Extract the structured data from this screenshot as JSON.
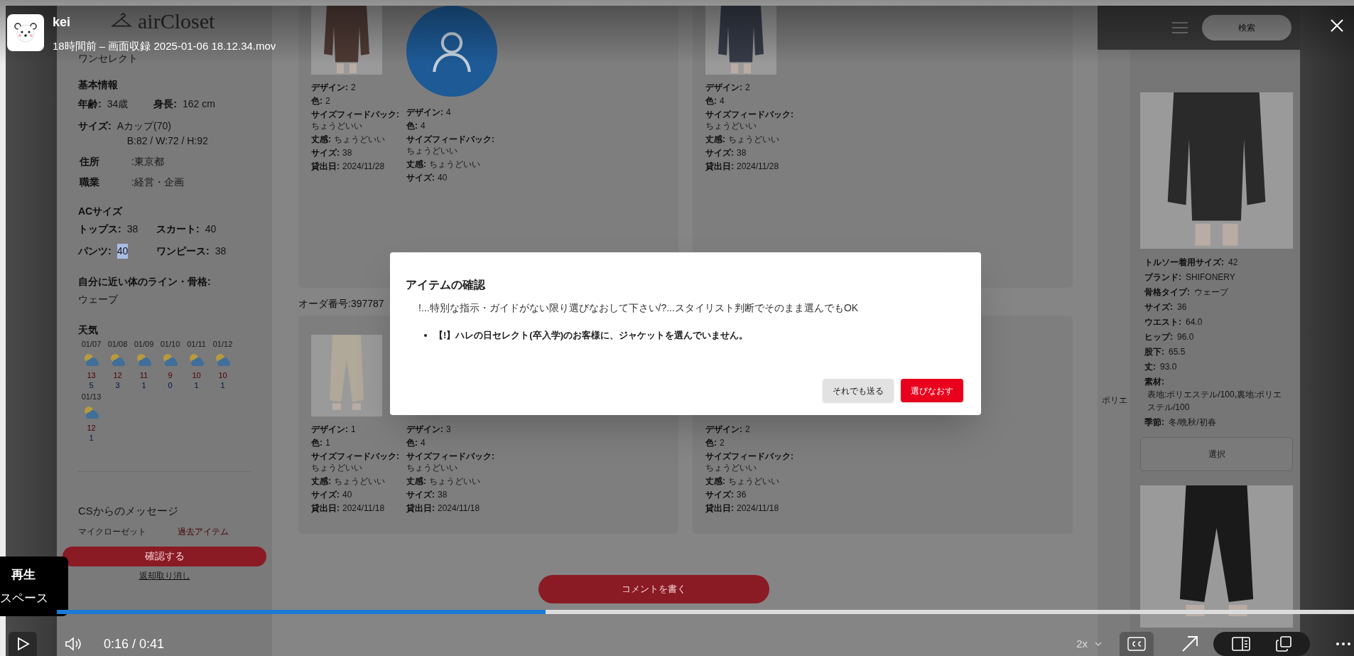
{
  "player": {
    "uploader": "kei",
    "subtitle": "18時間前 – 画面収録 2025-01-06 18.12.34.mov",
    "progress": {
      "level": 0.377
    },
    "time": "0:16 / 0:41",
    "speed": "2x",
    "captions_on": true,
    "tooltip": {
      "label": "再生",
      "shortcut": "スペース"
    }
  },
  "app": {
    "logo": "airCloset",
    "sidebar": {
      "plan": "ワンセレクト",
      "basic_title": "基本情報",
      "age": {
        "label": "年齢:",
        "value": "34歳"
      },
      "height": {
        "label": "身長:",
        "value": "162 cm"
      },
      "size": {
        "label": "サイズ:",
        "cup": "Aカップ(70)",
        "measurements": "B:82 / W:72 / H:92"
      },
      "address": {
        "label": "住所",
        "value": ":東京都"
      },
      "job": {
        "label": "職業",
        "value": ":経営・企画"
      },
      "ac_size": {
        "title": "ACサイズ",
        "sizes": [
          {
            "label": "トップス:",
            "value": "38",
            "selected": false
          },
          {
            "label": "スカート:",
            "value": "40",
            "selected": false
          },
          {
            "label": "パンツ:",
            "value": "40",
            "selected": true
          },
          {
            "label": "ワンピース:",
            "value": "38",
            "selected": false
          }
        ]
      },
      "body_line": {
        "label": "自分に近い体のライン・骨格:",
        "value": "ウェーブ"
      },
      "weather": {
        "title": "天気",
        "days": [
          {
            "date": "01/07",
            "high": "13",
            "low": "5"
          },
          {
            "date": "01/08",
            "high": "12",
            "low": "3"
          },
          {
            "date": "01/09",
            "high": "11",
            "low": "1"
          },
          {
            "date": "01/10",
            "high": "9",
            "low": "0"
          },
          {
            "date": "01/11",
            "high": "10",
            "low": "1"
          },
          {
            "date": "01/12",
            "high": "10",
            "low": "1"
          },
          {
            "date": "01/13",
            "high": "12",
            "low": "1"
          }
        ]
      },
      "cs_message": {
        "title": "CSからのメッセージ",
        "tabs": [
          {
            "label": "マイクローゼット",
            "selected": false
          },
          {
            "label": "過去アイテム",
            "selected": true
          }
        ],
        "confirm_button": "確認する",
        "cancel_link": "返却取り消し"
      }
    },
    "orders": [
      {
        "cards": [
          {
            "items": [
              {
                "fields": [
                  {
                    "label": "デザイン:",
                    "value": "2"
                  },
                  {
                    "label": "色:",
                    "value": "2"
                  },
                  {
                    "label": "サイズフィードバック:",
                    "value": "ちょうどいい",
                    "block": true
                  },
                  {
                    "label": "丈感:",
                    "value": "ちょうどいい"
                  },
                  {
                    "label": "サイズ:",
                    "value": "38"
                  },
                  {
                    "label": "貸出日:",
                    "value": "2024/11/28"
                  }
                ]
              },
              {
                "kind": "avatar",
                "fields": [
                  {
                    "label": "デザイン:",
                    "value": "4"
                  },
                  {
                    "label": "色:",
                    "value": "4"
                  },
                  {
                    "label": "サイズフィードバック:",
                    "value": "ちょうどいい",
                    "block": true
                  },
                  {
                    "label": "丈感:",
                    "value": "ちょうどいい"
                  },
                  {
                    "label": "サイズ:",
                    "value": "40"
                  }
                ]
              }
            ]
          },
          {
            "items": [
              {
                "fields": [
                  {
                    "label": "デザイン:",
                    "value": "2"
                  },
                  {
                    "label": "色:",
                    "value": "4"
                  },
                  {
                    "label": "サイズフィードバック:",
                    "value": "ちょうどいい",
                    "block": true
                  },
                  {
                    "label": "丈感:",
                    "value": "ちょうどいい"
                  },
                  {
                    "label": "サイズ:",
                    "value": "38"
                  },
                  {
                    "label": "貸出日:",
                    "value": "2024/11/28"
                  }
                ]
              }
            ]
          }
        ]
      },
      {
        "order_number": "オーダ番号:397787",
        "cards": [
          {
            "items": [
              {
                "fields": [
                  {
                    "label": "デザイン:",
                    "value": "1"
                  },
                  {
                    "label": "色:",
                    "value": "1"
                  },
                  {
                    "label": "サイズフィードバック:",
                    "value": "ちょうどいい",
                    "block": true
                  },
                  {
                    "label": "丈感:",
                    "value": "ちょうどいい"
                  },
                  {
                    "label": "サイズ:",
                    "value": "40"
                  },
                  {
                    "label": "貸出日:",
                    "value": "2024/11/18"
                  }
                ]
              },
              {
                "kind": "hidden",
                "fields": [
                  {
                    "label": "デザイン:",
                    "value": "3"
                  },
                  {
                    "label": "色:",
                    "value": "4"
                  },
                  {
                    "label": "サイズフィードバック:",
                    "value": "ちょうどいい",
                    "block": true
                  },
                  {
                    "label": "丈感:",
                    "value": "ちょうどいい"
                  },
                  {
                    "label": "サイズ:",
                    "value": "38"
                  },
                  {
                    "label": "貸出日:",
                    "value": "2024/11/18"
                  }
                ]
              }
            ]
          },
          {
            "items": [
              {
                "kind": "hidden",
                "fields": [
                  {
                    "label": "デザイン:",
                    "value": "2"
                  },
                  {
                    "label": "色:",
                    "value": "2"
                  },
                  {
                    "label": "サイズフィードバック:",
                    "value": "ちょうどいい",
                    "block": true
                  },
                  {
                    "label": "丈感:",
                    "value": "ちょうどいい"
                  },
                  {
                    "label": "サイズ:",
                    "value": "36"
                  },
                  {
                    "label": "貸出日:",
                    "value": "2024/11/18"
                  }
                ]
              }
            ]
          }
        ]
      }
    ],
    "comment_button": "コメントを書く",
    "product_panel": {
      "search_button": "検索",
      "side_fragment": "ポリエ",
      "details": [
        {
          "label": "トルソー着用サイズ:",
          "value": "42"
        },
        {
          "label": "ブランド:",
          "value": "SHIFONERY"
        },
        {
          "label": "骨格タイプ:",
          "value": "ウェーブ"
        },
        {
          "label": "サイズ:",
          "value": "36"
        },
        {
          "label": "ウエスト:",
          "value": "64.0"
        },
        {
          "label": "ヒップ:",
          "value": "96.0"
        },
        {
          "label": "股下:",
          "value": "65.5"
        },
        {
          "label": "丈:",
          "value": "93.0"
        },
        {
          "label": "素材:",
          "value": "表地:ポリエステル/100,裏地:ポリエステル/100",
          "block": true
        },
        {
          "label": "季節:",
          "value": "冬/晩秋/初春"
        }
      ],
      "select_button": "選択"
    }
  },
  "dialog": {
    "title": "アイテムの確認",
    "message": "!...特別な指示・ガイドがない限り選びなおして下さい/?...スタイリスト判断でそのまま選んでもOK",
    "warnings": [
      "【!】ハレの日セレクト(卒入学)のお客様に、ジャケットを選んでいません。"
    ],
    "buttons": [
      {
        "label": "それでも送る",
        "kind": "secondary"
      },
      {
        "label": "選びなおす",
        "kind": "primary"
      }
    ]
  }
}
